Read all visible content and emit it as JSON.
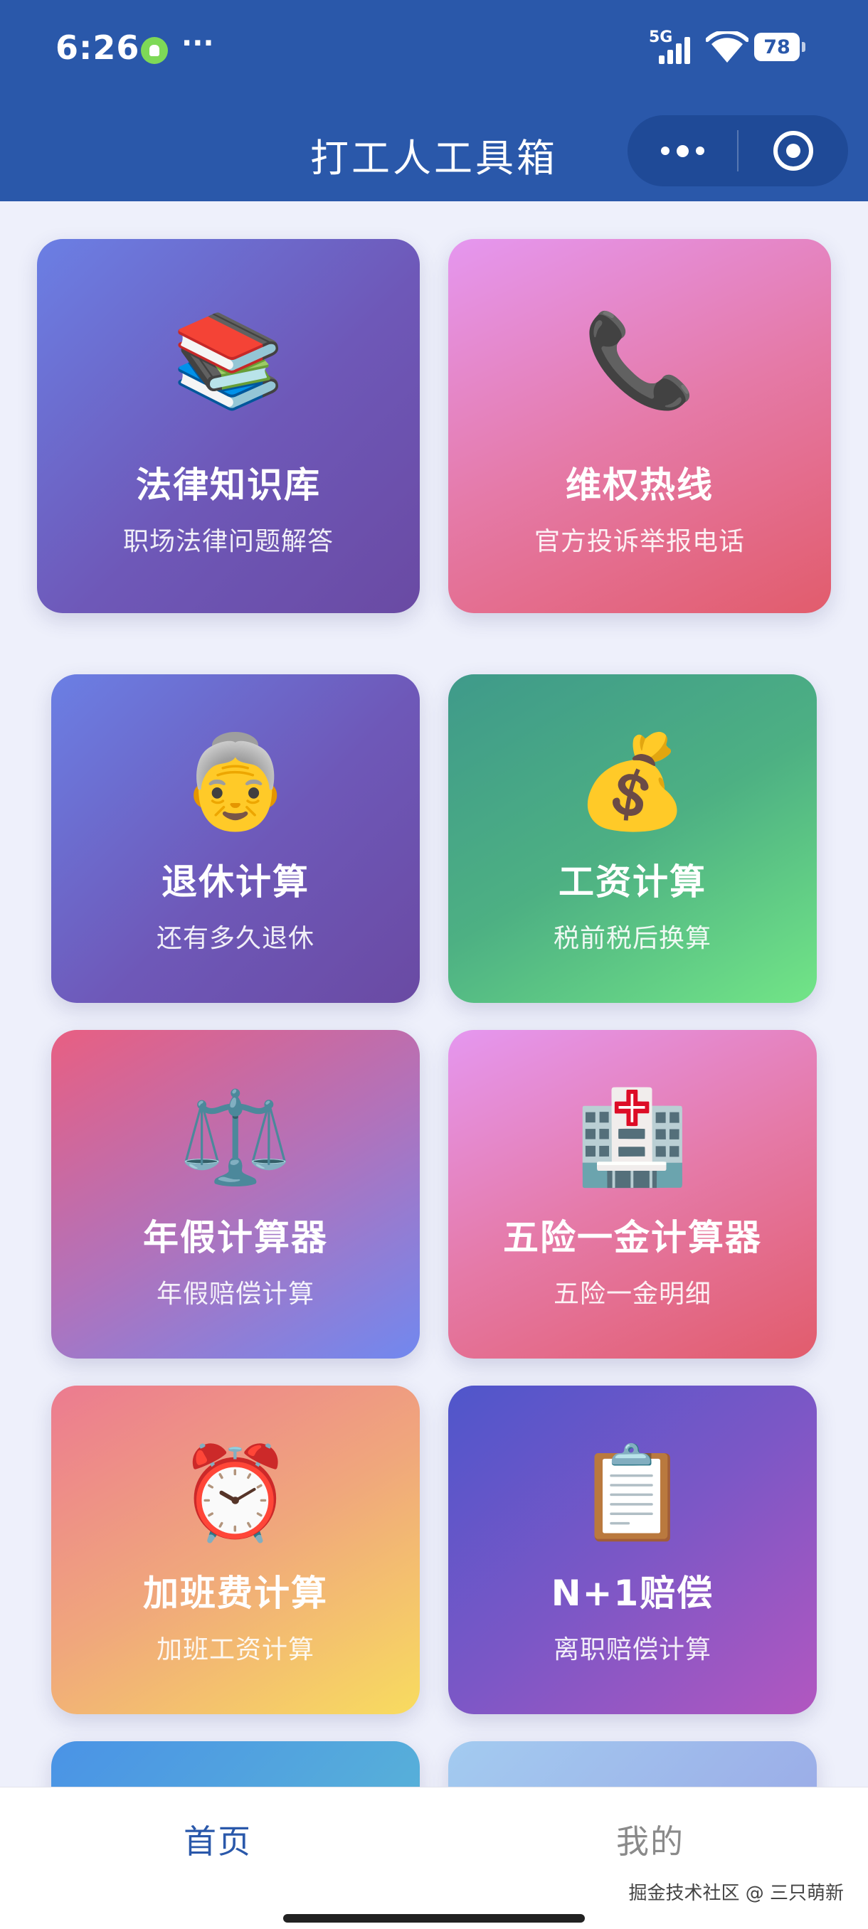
{
  "status_bar": {
    "time": "6:26",
    "more_indicator": "···",
    "network": "5G",
    "battery": "78"
  },
  "header": {
    "title": "打工人工具箱",
    "capsule": {
      "more_icon": "more-dots-icon",
      "close_icon": "target-circle-icon"
    }
  },
  "tools": [
    {
      "title": "法律知识库",
      "subtitle": "职场法律问题解答",
      "icon": "📚",
      "icon_name": "books-icon",
      "gradient": "purple"
    },
    {
      "title": "维权热线",
      "subtitle": "官方投诉举报电话",
      "icon": "📞",
      "icon_name": "telephone-icon",
      "gradient": "pink"
    },
    {
      "title": "退休计算",
      "subtitle": "还有多久退休",
      "icon": "👵",
      "icon_name": "old-person-icon",
      "gradient": "purple"
    },
    {
      "title": "工资计算",
      "subtitle": "税前税后换算",
      "icon": "💰",
      "icon_name": "money-bag-icon",
      "gradient": "green"
    },
    {
      "title": "年假计算器",
      "subtitle": "年假赔偿计算",
      "icon": "⚖️",
      "icon_name": "scales-icon",
      "gradient": "rose"
    },
    {
      "title": "五险一金计算器",
      "subtitle": "五险一金明细",
      "icon": "🏥",
      "icon_name": "hospital-icon",
      "gradient": "pink"
    },
    {
      "title": "加班费计算",
      "subtitle": "加班工资计算",
      "icon": "⏰",
      "icon_name": "alarm-clock-icon",
      "gradient": "orange"
    },
    {
      "title": "N+1赔偿",
      "subtitle": "离职赔偿计算",
      "icon": "📋",
      "icon_name": "clipboard-icon",
      "gradient": "violet"
    }
  ],
  "tabbar": {
    "home": "首页",
    "mine": "我的"
  },
  "watermark": "掘金技术社区 @ 三只萌新",
  "colors": {
    "header_bg": "#2a58aa",
    "page_bg": "#eef0fb",
    "tab_active": "#2a58aa",
    "tab_inactive": "#8a8a8a"
  }
}
